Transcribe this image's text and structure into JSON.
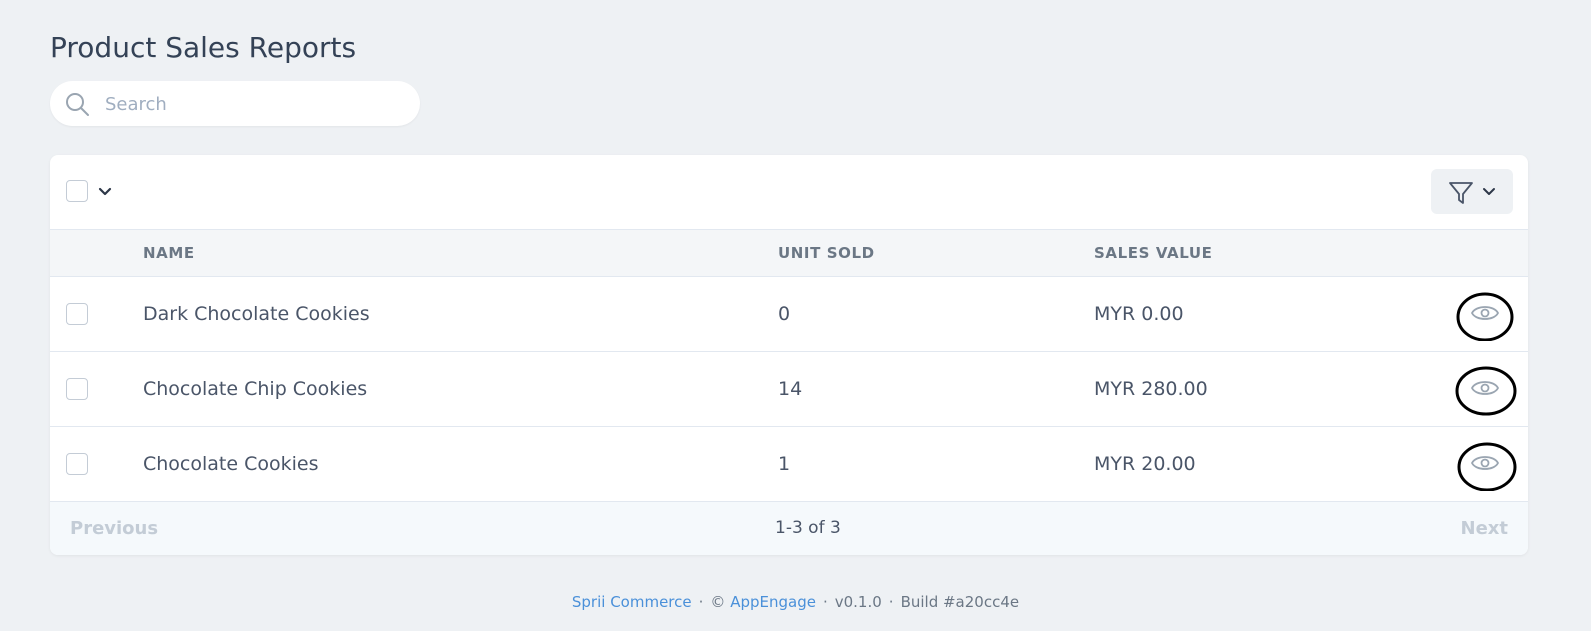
{
  "page": {
    "title": "Product Sales Reports"
  },
  "search": {
    "placeholder": "Search",
    "value": ""
  },
  "table": {
    "columns": {
      "name": "NAME",
      "units_sold": "UNIT SOLD",
      "sales_value": "SALES VALUE"
    },
    "rows": [
      {
        "name": "Dark Chocolate Cookies",
        "units_sold": "0",
        "sales_value": "MYR 0.00"
      },
      {
        "name": "Chocolate Chip Cookies",
        "units_sold": "14",
        "sales_value": "MYR 280.00"
      },
      {
        "name": "Chocolate Cookies",
        "units_sold": "1",
        "sales_value": "MYR 20.00"
      }
    ]
  },
  "pagination": {
    "previous_label": "Previous",
    "range_label": "1-3 of 3",
    "next_label": "Next"
  },
  "footer": {
    "brand": "Sprii Commerce",
    "copyright_symbol": "©",
    "company": "AppEngage",
    "version": "v0.1.0",
    "build": "Build #a20cc4e",
    "separator": "·"
  },
  "colors": {
    "background": "#eef1f4",
    "link": "#4a90d9",
    "muted": "#a0aec0"
  },
  "icons": {
    "search": "search-icon",
    "filter": "filter-icon",
    "caret": "chevron-down-icon",
    "view": "eye-icon"
  }
}
